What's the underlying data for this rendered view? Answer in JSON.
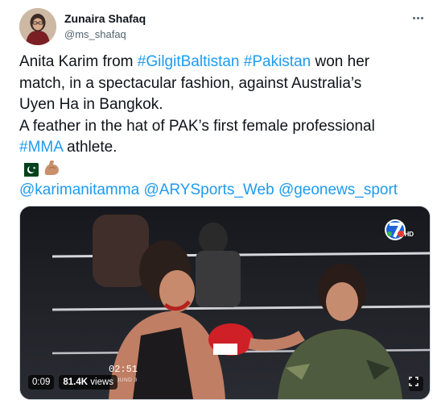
{
  "author": {
    "display_name": "Zunaira Shafaq",
    "handle": "@ms_shafaq",
    "avatar_icon": "profile-photo"
  },
  "menu_icon": "more-dots-icon",
  "tweet": {
    "line1_pre": "Anita Karim from ",
    "line1_tag1": "#GilgitBaltistan",
    "line1_space": " ",
    "line1_tag2": "#Pakistan",
    "line1_post": " won her",
    "line2": "match, in a spectacular fashion, against Australia’s",
    "line3": "Uyen Ha in Bangkok.",
    "line4": "A feather in the hat of PAK’s first female professional",
    "line5_tag": "#MMA",
    "line5_post": " athlete.",
    "emojis": [
      "pakistan-flag-emoji",
      "flexed-biceps-emoji"
    ],
    "mentions": [
      "@karimanitamma",
      "@ARYSports_Web",
      "@geonews_sport"
    ]
  },
  "video": {
    "elapsed": "0:09",
    "views_count": "81.4K",
    "views_label": " views",
    "broadcast_clock": "02:51",
    "broadcast_round": "ROUND 3",
    "channel_badge": "HD",
    "expand_icon": "expand-icon"
  },
  "colors": {
    "link": "#1d9bf0",
    "text": "#0f1419",
    "muted": "#536471"
  }
}
